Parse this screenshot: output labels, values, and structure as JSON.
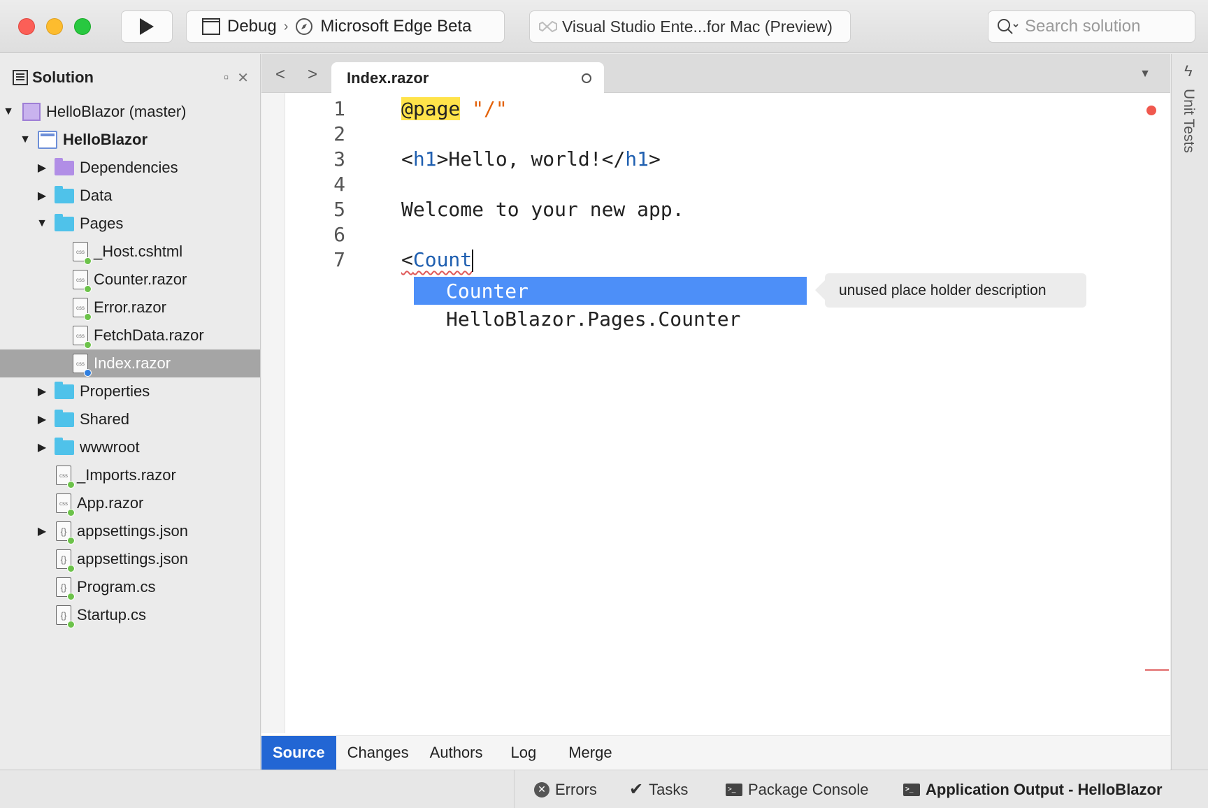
{
  "toolbar": {
    "configuration": "Debug",
    "target": "Microsoft Edge Beta",
    "status": "Visual Studio Ente...for Mac (Preview)",
    "search_placeholder": "Search solution"
  },
  "solution_pad": {
    "title": "Solution",
    "tree": [
      {
        "label": "HelloBlazor (master)"
      },
      {
        "label": "HelloBlazor"
      },
      {
        "label": "Dependencies"
      },
      {
        "label": "Data"
      },
      {
        "label": "Pages"
      },
      {
        "label": "_Host.cshtml"
      },
      {
        "label": "Counter.razor"
      },
      {
        "label": "Error.razor"
      },
      {
        "label": "FetchData.razor"
      },
      {
        "label": "Index.razor"
      },
      {
        "label": "Properties"
      },
      {
        "label": "Shared"
      },
      {
        "label": "wwwroot"
      },
      {
        "label": "_Imports.razor"
      },
      {
        "label": "App.razor"
      },
      {
        "label": "appsettings.json"
      },
      {
        "label": "appsettings.json"
      },
      {
        "label": "Program.cs"
      },
      {
        "label": "Startup.cs"
      }
    ]
  },
  "editor": {
    "tab_title": "Index.razor",
    "line_numbers": [
      "1",
      "2",
      "3",
      "4",
      "5",
      "6",
      "7"
    ],
    "code": {
      "l1_directive": "@page",
      "l1_string": "\"/\"",
      "l3_open_lt": "<",
      "l3_tag": "h1",
      "l3_mid": ">Hello, world!</",
      "l3_close_tag": "h1",
      "l3_gt": ">",
      "l5": "Welcome to your new app.",
      "l7_lt": "<",
      "l7_typed": "Count"
    },
    "completion": {
      "items": [
        "Counter",
        "HelloBlazor.Pages.Counter"
      ],
      "description": "unused place holder description"
    },
    "bottom_tabs": [
      "Source",
      "Changes",
      "Authors",
      "Log",
      "Merge"
    ]
  },
  "right_pad": {
    "label": "Unit Tests"
  },
  "statusbar": {
    "errors": "Errors",
    "tasks": "Tasks",
    "package_console": "Package Console",
    "app_output": "Application Output - HelloBlazor"
  },
  "colors": {
    "accent": "#2266d4",
    "completion_selected": "#4d8ff8",
    "folder": "#4fc2ea",
    "directive_highlight": "#ffe34a",
    "string": "#e36209"
  }
}
